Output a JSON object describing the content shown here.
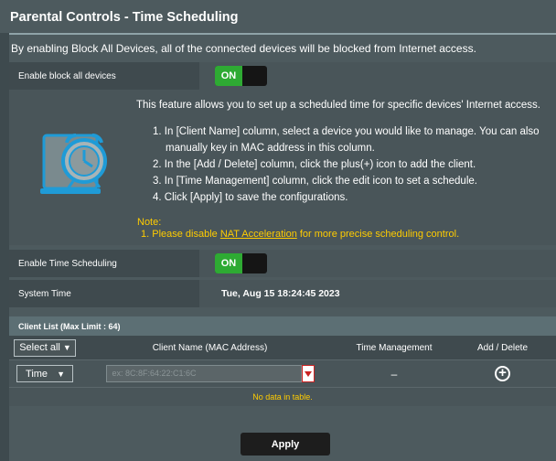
{
  "page": {
    "title": "Parental Controls - Time Scheduling",
    "description": "By enabling Block All Devices, all of the connected devices will be blocked from Internet access."
  },
  "block_all": {
    "label": "Enable block all devices",
    "toggle": "ON",
    "enabled": true
  },
  "info": {
    "intro": "This feature allows you to set up a scheduled time for specific devices' Internet access.",
    "steps": [
      "1. In [Client Name] column, select a device you would like to manage. You can also",
      "manually key in MAC address in this column.",
      "2. In the [Add / Delete] column, click the plus(+) icon to add the client.",
      "3. In [Time Management] column, click the edit icon to set a schedule.",
      "4. Click [Apply] to save the configurations."
    ],
    "note_title": "Note:",
    "note_prefix": "1. Please disable",
    "note_link": "NAT Acceleration",
    "note_suffix": "for more precise scheduling control.",
    "icon": "alarm-clock-monitor-icon"
  },
  "time_scheduling": {
    "label": "Enable Time Scheduling",
    "toggle": "ON",
    "enabled": true
  },
  "system_time": {
    "label": "System Time",
    "value": "Tue, Aug 15 18:24:45 2023"
  },
  "client_list": {
    "header": "Client List (Max Limit : 64)",
    "columns": {
      "select": "Select all",
      "client_name": "Client Name (MAC Address)",
      "time_management": "Time Management",
      "add_delete": "Add / Delete"
    },
    "new_row": {
      "mode": "Time",
      "mac_placeholder": "ex: 8C:8F:64:22:C1:6C",
      "time_management": "–"
    },
    "empty_text": "No data in table."
  },
  "apply_label": "Apply",
  "colors": {
    "toggle_on": "#2eaa33",
    "note": "#ffcc00",
    "background": "#4d5a5e"
  }
}
